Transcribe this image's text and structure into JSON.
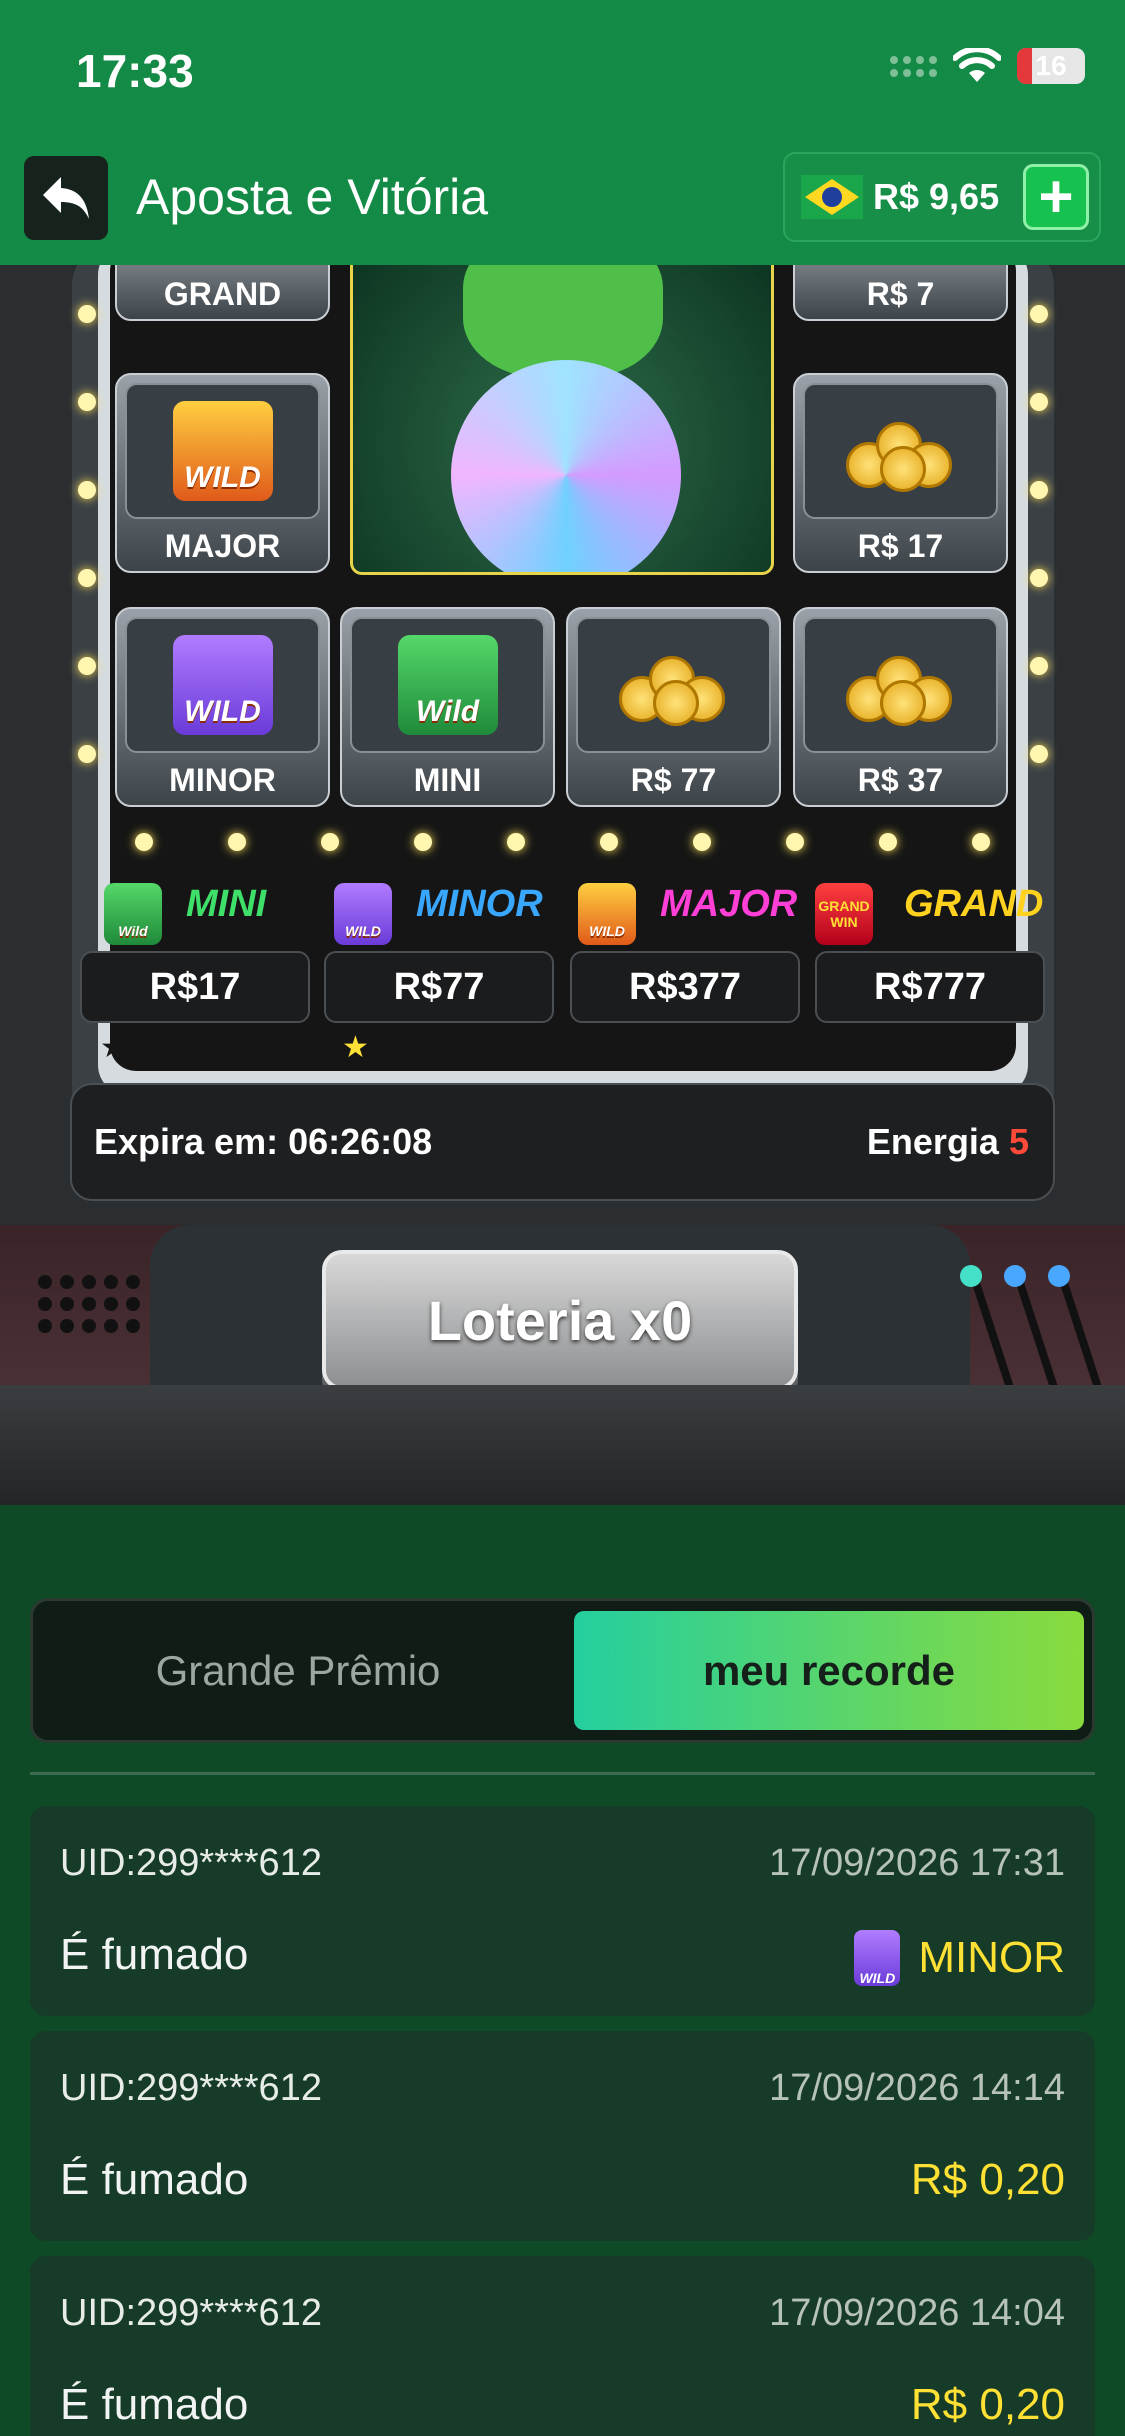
{
  "status_bar": {
    "time": "17:33",
    "battery": "16"
  },
  "header": {
    "title": "Aposta e Vitória",
    "balance": "R$ 9,65",
    "flag_icon": "brazil-flag-icon",
    "back_icon": "back-arrow-icon",
    "plus_label": "+"
  },
  "slot_grid": {
    "cells": [
      {
        "label": "GRAND"
      },
      {
        "label": "R$ 7"
      },
      {
        "label": "MAJOR",
        "badge": "WILD"
      },
      {
        "label": "R$ 17"
      },
      {
        "label": "MINOR",
        "badge": "WILD"
      },
      {
        "label": "MINI",
        "badge": "Wild"
      },
      {
        "label": "R$ 77"
      },
      {
        "label": "R$ 37"
      }
    ]
  },
  "jackpots": [
    {
      "name": "MINI",
      "amount": "R$17",
      "stars": 0,
      "color": "#3ee06a",
      "badge": "Wild"
    },
    {
      "name": "MINOR",
      "amount": "R$77",
      "stars": 1,
      "color": "#3aa7ff",
      "badge": "WILD"
    },
    {
      "name": "MAJOR",
      "amount": "R$377",
      "stars": 0,
      "color": "#ff3fd6",
      "badge": "WILD"
    },
    {
      "name": "GRAND",
      "amount": "R$777",
      "stars": 0,
      "color": "#ffd21f",
      "badge": "GRAND WIN"
    }
  ],
  "info": {
    "expires_label": "Expira em: 06:26:08",
    "energy_label": "Energia",
    "energy_value": "5"
  },
  "lottery_button": "Loteria x0",
  "tabs": {
    "grand_prize": "Grande Prêmio",
    "my_record": "meu recorde"
  },
  "records": [
    {
      "uid": "UID:299****612",
      "date": "17/09/2026 17:31",
      "text": "É fumado",
      "prize": "MINOR",
      "badge": "WILD"
    },
    {
      "uid": "UID:299****612",
      "date": "17/09/2026 14:14",
      "text": "É fumado",
      "prize": "R$ 0,20"
    },
    {
      "uid": "UID:299****612",
      "date": "17/09/2026 14:04",
      "text": "É fumado",
      "prize": "R$ 0,20"
    }
  ]
}
